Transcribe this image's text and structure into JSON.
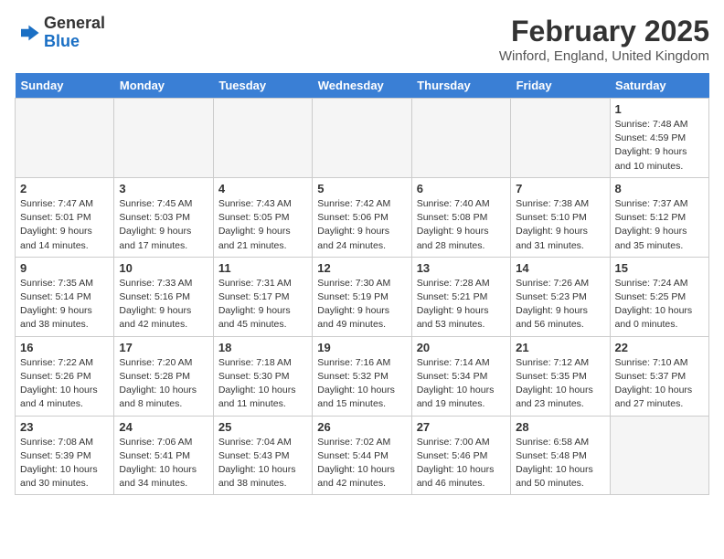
{
  "header": {
    "logo_general": "General",
    "logo_blue": "Blue",
    "month_year": "February 2025",
    "location": "Winford, England, United Kingdom"
  },
  "weekdays": [
    "Sunday",
    "Monday",
    "Tuesday",
    "Wednesday",
    "Thursday",
    "Friday",
    "Saturday"
  ],
  "weeks": [
    [
      {
        "day": null
      },
      {
        "day": null
      },
      {
        "day": null
      },
      {
        "day": null
      },
      {
        "day": null
      },
      {
        "day": null
      },
      {
        "day": "1",
        "sunrise": "Sunrise: 7:48 AM",
        "sunset": "Sunset: 4:59 PM",
        "daylight": "Daylight: 9 hours and 10 minutes."
      }
    ],
    [
      {
        "day": "2",
        "sunrise": "Sunrise: 7:47 AM",
        "sunset": "Sunset: 5:01 PM",
        "daylight": "Daylight: 9 hours and 14 minutes."
      },
      {
        "day": "3",
        "sunrise": "Sunrise: 7:45 AM",
        "sunset": "Sunset: 5:03 PM",
        "daylight": "Daylight: 9 hours and 17 minutes."
      },
      {
        "day": "4",
        "sunrise": "Sunrise: 7:43 AM",
        "sunset": "Sunset: 5:05 PM",
        "daylight": "Daylight: 9 hours and 21 minutes."
      },
      {
        "day": "5",
        "sunrise": "Sunrise: 7:42 AM",
        "sunset": "Sunset: 5:06 PM",
        "daylight": "Daylight: 9 hours and 24 minutes."
      },
      {
        "day": "6",
        "sunrise": "Sunrise: 7:40 AM",
        "sunset": "Sunset: 5:08 PM",
        "daylight": "Daylight: 9 hours and 28 minutes."
      },
      {
        "day": "7",
        "sunrise": "Sunrise: 7:38 AM",
        "sunset": "Sunset: 5:10 PM",
        "daylight": "Daylight: 9 hours and 31 minutes."
      },
      {
        "day": "8",
        "sunrise": "Sunrise: 7:37 AM",
        "sunset": "Sunset: 5:12 PM",
        "daylight": "Daylight: 9 hours and 35 minutes."
      }
    ],
    [
      {
        "day": "9",
        "sunrise": "Sunrise: 7:35 AM",
        "sunset": "Sunset: 5:14 PM",
        "daylight": "Daylight: 9 hours and 38 minutes."
      },
      {
        "day": "10",
        "sunrise": "Sunrise: 7:33 AM",
        "sunset": "Sunset: 5:16 PM",
        "daylight": "Daylight: 9 hours and 42 minutes."
      },
      {
        "day": "11",
        "sunrise": "Sunrise: 7:31 AM",
        "sunset": "Sunset: 5:17 PM",
        "daylight": "Daylight: 9 hours and 45 minutes."
      },
      {
        "day": "12",
        "sunrise": "Sunrise: 7:30 AM",
        "sunset": "Sunset: 5:19 PM",
        "daylight": "Daylight: 9 hours and 49 minutes."
      },
      {
        "day": "13",
        "sunrise": "Sunrise: 7:28 AM",
        "sunset": "Sunset: 5:21 PM",
        "daylight": "Daylight: 9 hours and 53 minutes."
      },
      {
        "day": "14",
        "sunrise": "Sunrise: 7:26 AM",
        "sunset": "Sunset: 5:23 PM",
        "daylight": "Daylight: 9 hours and 56 minutes."
      },
      {
        "day": "15",
        "sunrise": "Sunrise: 7:24 AM",
        "sunset": "Sunset: 5:25 PM",
        "daylight": "Daylight: 10 hours and 0 minutes."
      }
    ],
    [
      {
        "day": "16",
        "sunrise": "Sunrise: 7:22 AM",
        "sunset": "Sunset: 5:26 PM",
        "daylight": "Daylight: 10 hours and 4 minutes."
      },
      {
        "day": "17",
        "sunrise": "Sunrise: 7:20 AM",
        "sunset": "Sunset: 5:28 PM",
        "daylight": "Daylight: 10 hours and 8 minutes."
      },
      {
        "day": "18",
        "sunrise": "Sunrise: 7:18 AM",
        "sunset": "Sunset: 5:30 PM",
        "daylight": "Daylight: 10 hours and 11 minutes."
      },
      {
        "day": "19",
        "sunrise": "Sunrise: 7:16 AM",
        "sunset": "Sunset: 5:32 PM",
        "daylight": "Daylight: 10 hours and 15 minutes."
      },
      {
        "day": "20",
        "sunrise": "Sunrise: 7:14 AM",
        "sunset": "Sunset: 5:34 PM",
        "daylight": "Daylight: 10 hours and 19 minutes."
      },
      {
        "day": "21",
        "sunrise": "Sunrise: 7:12 AM",
        "sunset": "Sunset: 5:35 PM",
        "daylight": "Daylight: 10 hours and 23 minutes."
      },
      {
        "day": "22",
        "sunrise": "Sunrise: 7:10 AM",
        "sunset": "Sunset: 5:37 PM",
        "daylight": "Daylight: 10 hours and 27 minutes."
      }
    ],
    [
      {
        "day": "23",
        "sunrise": "Sunrise: 7:08 AM",
        "sunset": "Sunset: 5:39 PM",
        "daylight": "Daylight: 10 hours and 30 minutes."
      },
      {
        "day": "24",
        "sunrise": "Sunrise: 7:06 AM",
        "sunset": "Sunset: 5:41 PM",
        "daylight": "Daylight: 10 hours and 34 minutes."
      },
      {
        "day": "25",
        "sunrise": "Sunrise: 7:04 AM",
        "sunset": "Sunset: 5:43 PM",
        "daylight": "Daylight: 10 hours and 38 minutes."
      },
      {
        "day": "26",
        "sunrise": "Sunrise: 7:02 AM",
        "sunset": "Sunset: 5:44 PM",
        "daylight": "Daylight: 10 hours and 42 minutes."
      },
      {
        "day": "27",
        "sunrise": "Sunrise: 7:00 AM",
        "sunset": "Sunset: 5:46 PM",
        "daylight": "Daylight: 10 hours and 46 minutes."
      },
      {
        "day": "28",
        "sunrise": "Sunrise: 6:58 AM",
        "sunset": "Sunset: 5:48 PM",
        "daylight": "Daylight: 10 hours and 50 minutes."
      },
      {
        "day": null
      }
    ]
  ]
}
